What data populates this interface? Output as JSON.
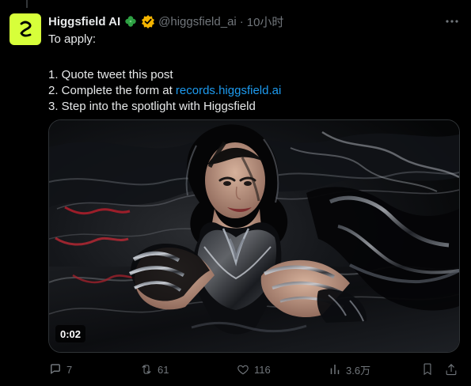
{
  "tweet": {
    "display_name": "Higgsfield AI",
    "handle": "@higgsfield_ai",
    "separator": "·",
    "time": "10小时",
    "body": {
      "intro": "To apply:",
      "step1": "1. Quote tweet this post",
      "step2_prefix": "2. Complete the form at ",
      "step2_link": "records.higgsfield.ai",
      "step3": "3. Step into the spotlight with Higgsfield"
    },
    "media": {
      "video_timestamp": "0:02"
    }
  },
  "actions": {
    "reply_count": "7",
    "retweet_count": "61",
    "like_count": "116",
    "view_count": "3.6万"
  },
  "icons": {
    "avatar": "higgsfield-logo-icon",
    "name_badge": "clover-icon",
    "verified": "verified-badge-icon",
    "more": "more-horizontal-icon",
    "reply": "reply-icon",
    "retweet": "retweet-icon",
    "like": "heart-icon",
    "views": "views-icon",
    "bookmark": "bookmark-icon",
    "share": "share-icon"
  },
  "colors": {
    "background": "#000000",
    "text": "#e7e9ea",
    "muted": "#71767b",
    "link": "#1d9bf0",
    "avatar_bg": "#d7ff3a",
    "verified_gold": "#f4b400",
    "clover_green": "#2ea043"
  }
}
